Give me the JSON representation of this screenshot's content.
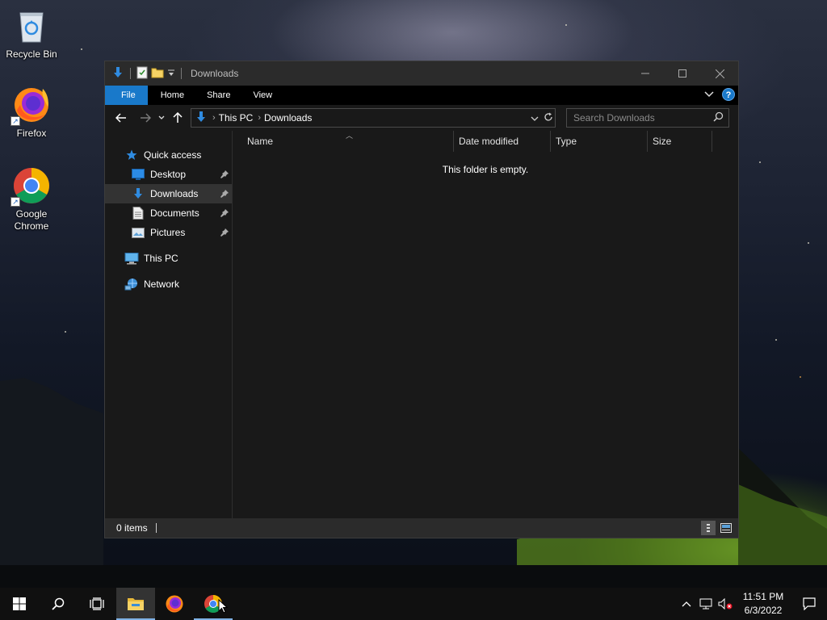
{
  "desktop": {
    "icons": [
      {
        "label": "Recycle Bin",
        "icon": "recycle-bin-icon"
      },
      {
        "label": "Firefox",
        "icon": "firefox-icon"
      },
      {
        "label": "Google\nChrome",
        "icon": "chrome-icon"
      }
    ]
  },
  "window": {
    "title": "Downloads",
    "controls": {
      "minimize": "minimize-icon",
      "maximize": "maximize-icon",
      "close": "close-icon"
    },
    "ribbon": {
      "tabs": [
        "File",
        "Home",
        "Share",
        "View"
      ],
      "help_label": "?"
    },
    "address": {
      "crumbs": [
        "This PC",
        "Downloads"
      ]
    },
    "search": {
      "placeholder": "Search Downloads"
    },
    "nav_pane": {
      "quick_access": "Quick access",
      "pinned": [
        {
          "label": "Desktop",
          "icon": "desktop-folder-icon"
        },
        {
          "label": "Downloads",
          "icon": "downloads-folder-icon",
          "selected": true
        },
        {
          "label": "Documents",
          "icon": "documents-folder-icon"
        },
        {
          "label": "Pictures",
          "icon": "pictures-folder-icon"
        }
      ],
      "this_pc": "This PC",
      "network": "Network"
    },
    "columns": [
      "Name",
      "Date modified",
      "Type",
      "Size"
    ],
    "empty_message": "This folder is empty.",
    "status": {
      "item_count": "0 items"
    }
  },
  "taskbar": {
    "buttons": [
      "start-icon",
      "search-icon",
      "task-view-icon",
      "file-explorer-icon",
      "firefox-icon",
      "chrome-icon"
    ],
    "clock": {
      "time": "11:51 PM",
      "date": "6/3/2022"
    }
  },
  "colors": {
    "accent": "#1979ca",
    "window_bg": "#191919",
    "titlebar_bg": "#2b2b2b",
    "taskbar_bg": "#101010"
  }
}
